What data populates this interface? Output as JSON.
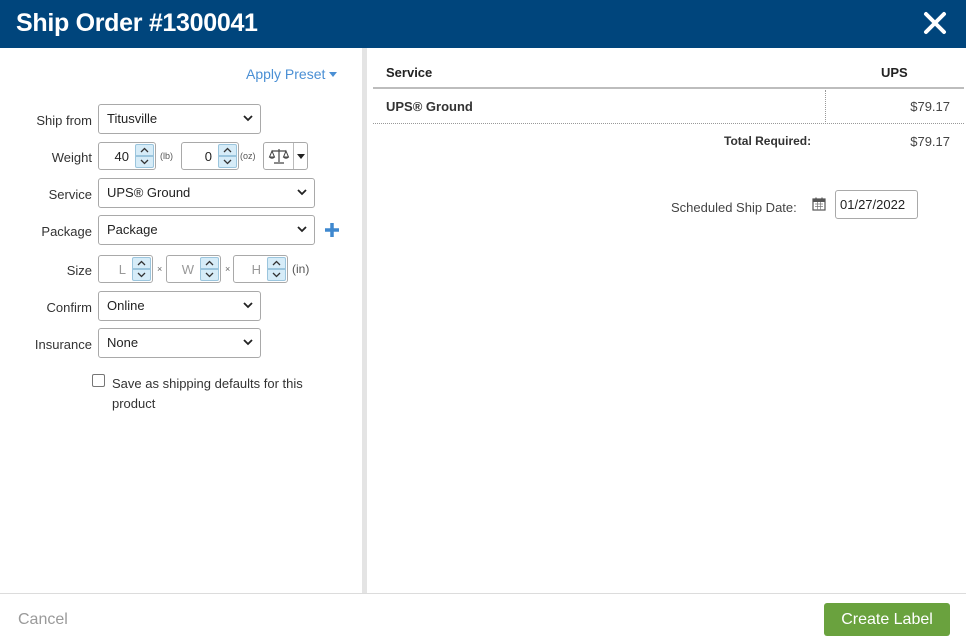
{
  "header": {
    "title": "Ship Order #1300041",
    "close_icon": "close-icon"
  },
  "left": {
    "apply_preset": "Apply Preset",
    "fields": {
      "ship_from": {
        "label": "Ship from",
        "value": "Titusville"
      },
      "weight": {
        "label": "Weight",
        "lb_value": "40",
        "lb_unit": "(lb)",
        "oz_value": "0",
        "oz_unit": "(oz)"
      },
      "service": {
        "label": "Service",
        "value": "UPS® Ground"
      },
      "package": {
        "label": "Package",
        "value": "Package"
      },
      "size": {
        "label": "Size",
        "l_placeholder": "L",
        "w_placeholder": "W",
        "h_placeholder": "H",
        "times": "×",
        "unit": "(in)"
      },
      "confirm": {
        "label": "Confirm",
        "value": "Online"
      },
      "insurance": {
        "label": "Insurance",
        "value": "None"
      }
    },
    "save_defaults": {
      "label": "Save as shipping defaults for this product",
      "checked": false
    }
  },
  "right": {
    "table": {
      "headers": {
        "service": "Service",
        "carrier": "UPS"
      },
      "rows": [
        {
          "service": "UPS® Ground",
          "price": "$79.17"
        }
      ],
      "total_label": "Total Required:",
      "total_value": "$79.17"
    },
    "scheduled_ship_date": {
      "label": "Scheduled Ship Date:",
      "value": "01/27/2022"
    }
  },
  "footer": {
    "cancel": "Cancel",
    "create_label": "Create Label"
  },
  "colors": {
    "header_bg": "#00457c",
    "link": "#4a8fd4",
    "primary_button": "#6aa23e",
    "spinner_bg": "#d6ecf8"
  }
}
